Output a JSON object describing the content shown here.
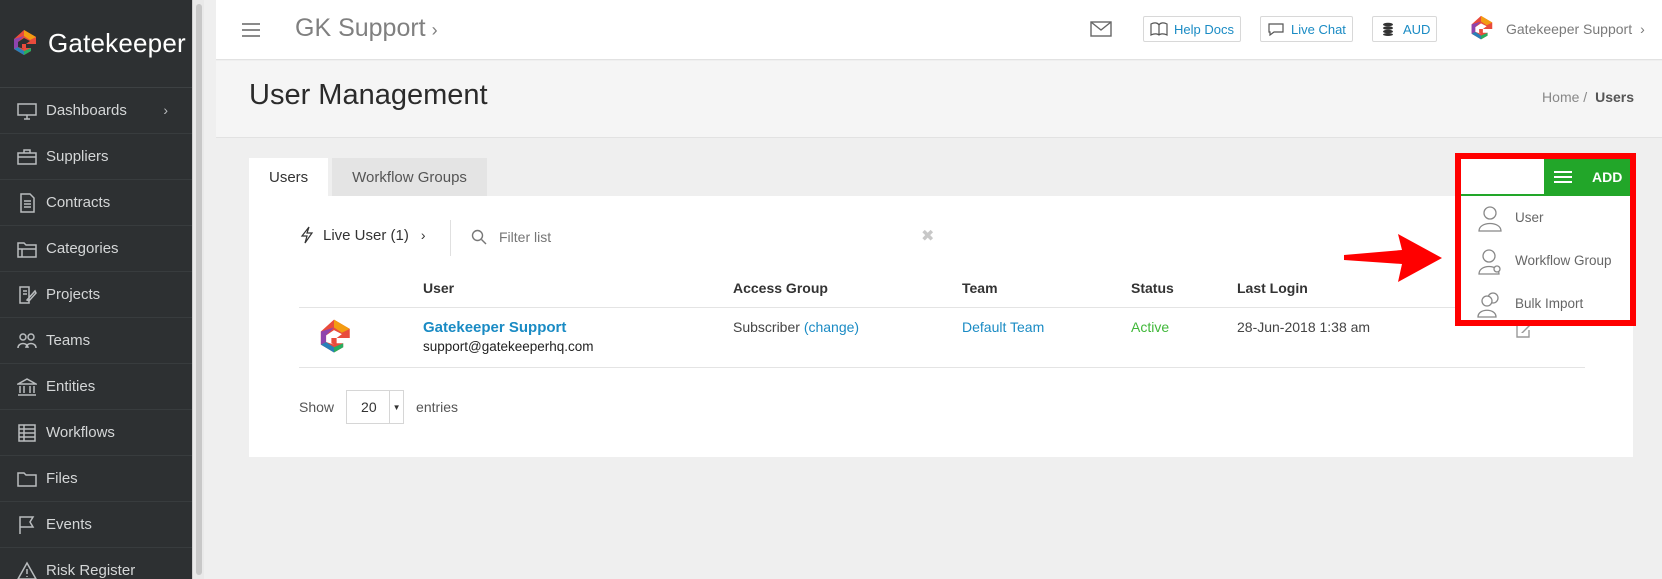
{
  "sidebar": {
    "brand": "Gatekeeper",
    "items": [
      {
        "label": "Dashboards",
        "icon": "monitor-icon",
        "has_chevron": true
      },
      {
        "label": "Suppliers",
        "icon": "briefcase-icon"
      },
      {
        "label": "Contracts",
        "icon": "document-icon"
      },
      {
        "label": "Categories",
        "icon": "folders-icon"
      },
      {
        "label": "Projects",
        "icon": "edit-document-icon"
      },
      {
        "label": "Teams",
        "icon": "people-icon"
      },
      {
        "label": "Entities",
        "icon": "bank-icon"
      },
      {
        "label": "Workflows",
        "icon": "grid-table-icon"
      },
      {
        "label": "Files",
        "icon": "folder-icon"
      },
      {
        "label": "Events",
        "icon": "flag-icon"
      },
      {
        "label": "Risk Register",
        "icon": "warning-icon"
      }
    ]
  },
  "topbar": {
    "title": "GK Support",
    "help_docs": "Help Docs",
    "live_chat": "Live Chat",
    "currency": "AUD",
    "profile_name": "Gatekeeper Support"
  },
  "page": {
    "title": "User Management",
    "breadcrumb_home": "Home",
    "breadcrumb_sep": "/",
    "breadcrumb_current": "Users"
  },
  "tabs": [
    {
      "label": "Users",
      "active": true
    },
    {
      "label": "Workflow Groups",
      "active": false
    }
  ],
  "toolbar": {
    "live_user": "Live User (1)",
    "filter_placeholder": "Filter list"
  },
  "table": {
    "columns": [
      "User",
      "Access Group",
      "Team",
      "Status",
      "Last Login"
    ],
    "rows": [
      {
        "name": "Gatekeeper Support",
        "email": "support@gatekeeperhq.com",
        "access_group": "Subscriber",
        "change_link": "(change)",
        "team": "Default Team",
        "status": "Active",
        "last_login": "28-Jun-2018 1:38 am"
      }
    ]
  },
  "pagination": {
    "show_label": "Show",
    "page_size": "20",
    "entries_label": "entries"
  },
  "add_menu": {
    "button_label": "ADD",
    "items": [
      {
        "label": "User",
        "icon": "user-icon"
      },
      {
        "label": "Workflow Group",
        "icon": "user-group-icon"
      },
      {
        "label": "Bulk Import",
        "icon": "users-import-icon"
      }
    ]
  },
  "colors": {
    "sidebar_bg": "#2d3032",
    "link_blue": "#1a8bc4",
    "active_green": "#41b83a",
    "add_green": "#22a629",
    "highlight_red": "#ff0000"
  }
}
